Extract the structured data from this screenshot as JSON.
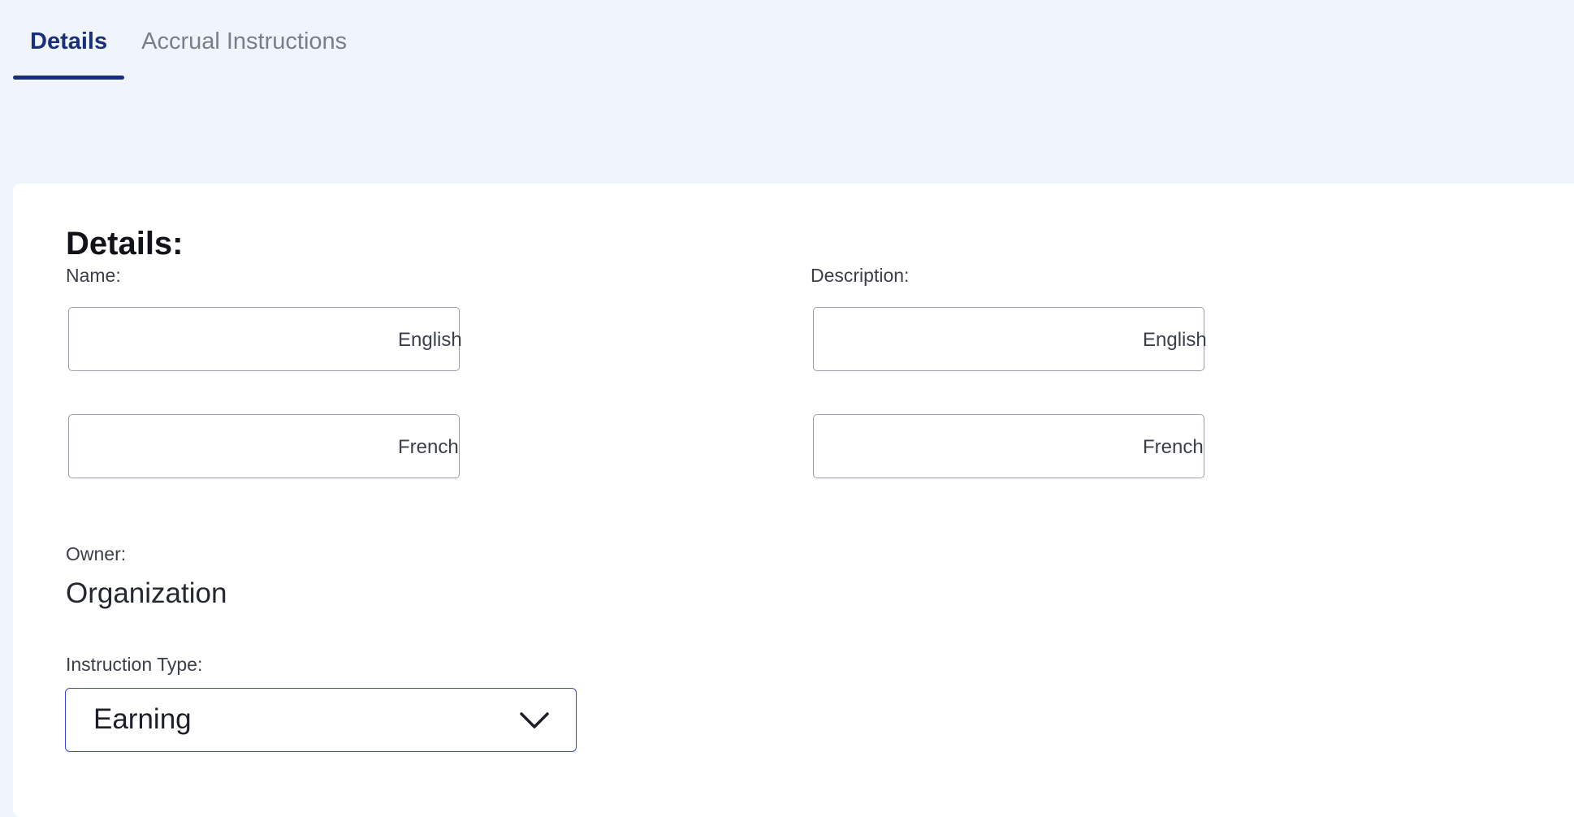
{
  "tabs": [
    {
      "label": "Details",
      "active": true
    },
    {
      "label": "Accrual Instructions",
      "active": false
    }
  ],
  "details": {
    "title": "Details:",
    "name": {
      "label": "Name:",
      "english": {
        "value": "",
        "lang_label": "English"
      },
      "french": {
        "value": "",
        "lang_label": "French"
      }
    },
    "description": {
      "label": "Description:",
      "english": {
        "value": "",
        "lang_label": "English"
      },
      "french": {
        "value": "",
        "lang_label": "French"
      }
    },
    "owner": {
      "label": "Owner:",
      "value": "Organization"
    },
    "instruction_type": {
      "label": "Instruction Type:",
      "selected": "Earning",
      "icon": "chevron-down-icon"
    }
  },
  "colors": {
    "background": "#f0f4fb",
    "accent": "#1a2f7a",
    "select_border": "#3b43d6",
    "input_border": "#9aa0aa"
  }
}
